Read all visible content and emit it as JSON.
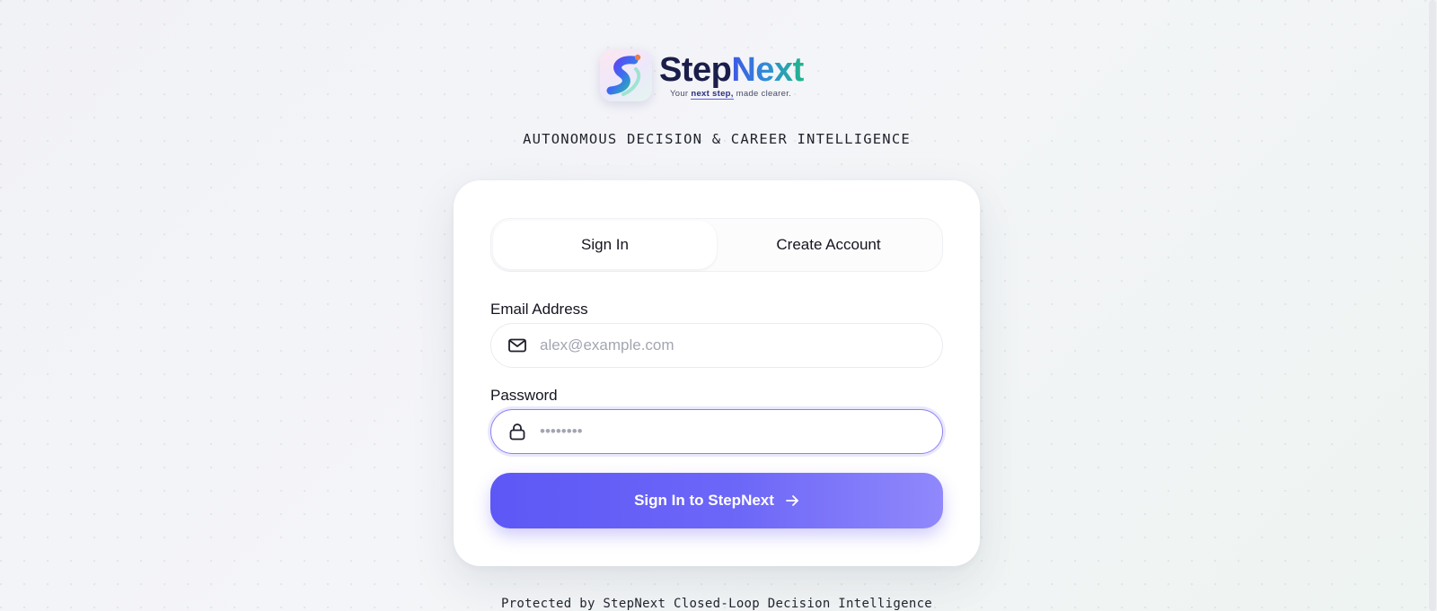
{
  "brand": {
    "name_part1": "Step",
    "name_part2": "Next",
    "tagline_pre": "Your ",
    "tagline_emph": "next step,",
    "tagline_post": " made clearer."
  },
  "subtitle": "AUTONOMOUS DECISION & CAREER INTELLIGENCE",
  "tabs": [
    {
      "label": "Sign In",
      "active": true
    },
    {
      "label": "Create Account",
      "active": false
    }
  ],
  "form": {
    "email": {
      "label": "Email Address",
      "placeholder": "alex@example.com",
      "value": "",
      "icon": "mail-icon"
    },
    "password": {
      "label": "Password",
      "placeholder": "••••••••",
      "value": "",
      "icon": "lock-icon"
    },
    "submit_label": "Sign In to StepNext",
    "submit_icon": "arrow-right-icon"
  },
  "footer": "Protected by StepNext Closed-Loop Decision Intelligence",
  "colors": {
    "accent": "#5d57f6",
    "accent_light": "#9088fb",
    "focus_ring": "#8c80f2",
    "brand_dark": "#1b1d4a",
    "brand_gradient_start": "#3f57e6",
    "brand_gradient_end": "#21b58a"
  }
}
